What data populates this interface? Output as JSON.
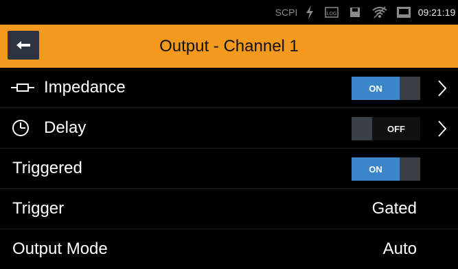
{
  "status": {
    "scpi": "SCPI",
    "time": "09:21:19",
    "icons": [
      "lightning-icon",
      "log-icon",
      "storage-icon",
      "wifi-icon",
      "screen-icon"
    ]
  },
  "header": {
    "title": "Output - Channel 1",
    "back_icon": "back-arrow-icon",
    "accent_color": "#f39a1e"
  },
  "rows": [
    {
      "label": "Impedance",
      "icon": "impedance-icon",
      "toggle": "ON",
      "has_chevron": true
    },
    {
      "label": "Delay",
      "icon": "clock-icon",
      "toggle": "OFF",
      "has_chevron": true
    },
    {
      "label": "Triggered",
      "toggle": "ON"
    },
    {
      "label": "Trigger",
      "value": "Gated"
    },
    {
      "label": "Output Mode",
      "value": "Auto"
    }
  ],
  "colors": {
    "toggle_on": "#3b86c9",
    "toggle_knob": "#3a3f46",
    "background": "#000000"
  }
}
